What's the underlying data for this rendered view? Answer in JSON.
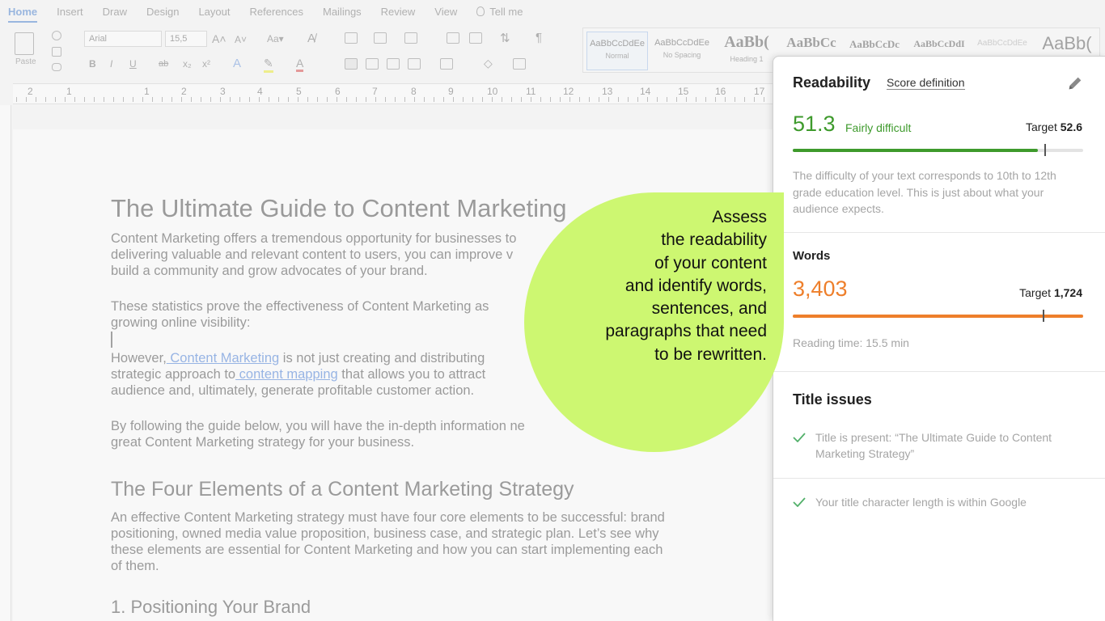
{
  "ribbon": {
    "tabs": [
      "Home",
      "Insert",
      "Draw",
      "Design",
      "Layout",
      "References",
      "Mailings",
      "Review",
      "View"
    ],
    "tell_me": "Tell me",
    "paste_label": "Paste",
    "font_name": "Arial",
    "font_size": "15,5",
    "styles": [
      {
        "sample": "AaBbCcDdEe",
        "name": "Normal"
      },
      {
        "sample": "AaBbCcDdEe",
        "name": "No Spacing"
      },
      {
        "sample": "AaBb(",
        "name": "Heading 1"
      },
      {
        "sample": "AaBbCc",
        "name": ""
      },
      {
        "sample": "AaBbCcDc",
        "name": ""
      },
      {
        "sample": "AaBbCcDdI",
        "name": ""
      },
      {
        "sample": "AaBbCcDdEe",
        "name": ""
      },
      {
        "sample": "AaBb(",
        "name": ""
      }
    ]
  },
  "ruler": {
    "numbers": [
      "2",
      "1",
      "1",
      "2",
      "3",
      "4",
      "5",
      "6",
      "7",
      "8",
      "9",
      "10",
      "11",
      "12",
      "13",
      "14",
      "15",
      "16",
      "17"
    ]
  },
  "document": {
    "title": "The Ultimate Guide to Content Marketing",
    "p1": [
      "Content Marketing offers a tremendous opportunity for businesses to",
      "delivering valuable and relevant content to users, you can improve v",
      "build a community and grow advocates of your brand."
    ],
    "p2": [
      "These statistics prove the effectiveness of Content Marketing as",
      "growing online visibility:"
    ],
    "p3": {
      "l1_pre": "However,",
      "l1_link": " Content Marketing",
      "l1_post": " is not just creating and distributing",
      "l2_pre": "strategic approach to",
      "l2_link": " content mapping",
      "l2_post": " that allows you to attract",
      "l3": "audience and, ultimately, generate profitable customer action."
    },
    "p4": [
      "By following the guide below, you will have the in-depth information ne",
      "great Content Marketing strategy for your business."
    ],
    "h2": "The Four Elements of a Content Marketing Strategy",
    "p5": [
      "An effective Content Marketing strategy must have four core elements to be successful: brand",
      "positioning, owned media value proposition, business case, and strategic plan. Let’s see why",
      "these elements are essential for Content Marketing and how you can start implementing each",
      "of them."
    ],
    "h3": "1. Positioning Your Brand"
  },
  "panel": {
    "readability": {
      "title": "Readability",
      "score_definition": "Score definition",
      "score": "51.3",
      "score_value": 51.3,
      "quality": "Fairly difficult",
      "target_label": "Target",
      "target": "52.6",
      "target_value": 52.6,
      "description": "The difficulty of your text corresponds to 10th to 12th grade education level. This is just about what your audience expects."
    },
    "words": {
      "title": "Words",
      "count": "3,403",
      "count_value": 3403,
      "target_label": "Target",
      "target": "1,724",
      "target_value": 1724,
      "reading_time": "Reading time: 15.5 min"
    },
    "title_issues": {
      "title": "Title issues",
      "items": [
        "Title is present: “The Ultimate Guide to Content Marketing Strategy”",
        "Your title character length is within Google"
      ]
    }
  },
  "callout": {
    "lines": [
      "Assess",
      "the readability",
      "of your content",
      "and identify words,",
      "sentences, and",
      "paragraphs that need",
      "to be rewritten."
    ]
  },
  "colors": {
    "readability_green": "#3e9a2c",
    "words_orange": "#ee7f2b",
    "callout_lime": "#cdf771",
    "link_blue": "#1a5fd0",
    "check_green": "#52b06a"
  }
}
